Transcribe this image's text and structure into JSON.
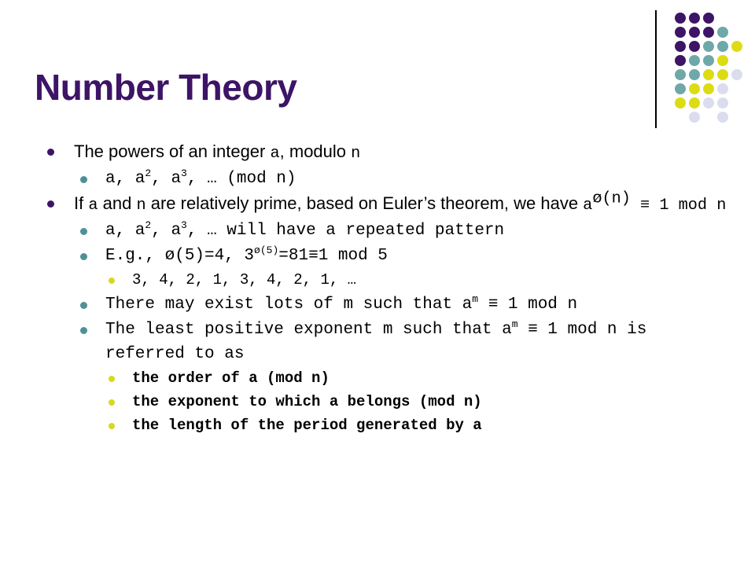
{
  "slide": {
    "title": "Number Theory",
    "title_color": "#3D1466",
    "background_color": "#FFFFFF"
  },
  "bullet_colors": {
    "level1": "#3D1466",
    "level2": "#4E9096",
    "level3": "#D9D91C"
  },
  "content": {
    "b1": {
      "pre": "The powers of an integer ",
      "mono1": "a",
      "mid": ", modulo ",
      "mono2": "n"
    },
    "b1_1": "a, a2, a3, … (mod n)",
    "b1_1_parts": {
      "p1": "a, a",
      "sup1": "2",
      "p2": ", a",
      "sup2": "3",
      "p3": ", … (mod n)"
    },
    "b2": {
      "pre": "If ",
      "mono1": "a",
      "mid1": " and ",
      "mono2": "n",
      "mid2": " are relatively prime, based on Euler’s theorem, we have ",
      "tail_base": "a",
      "tail_sup": "ø(n)",
      "tail_rest": " ≡ 1 mod n"
    },
    "b2_1": {
      "p1": "a, a",
      "sup1": "2",
      "p2": ", a",
      "sup2": "3",
      "p3": ", … will have a repeated pattern"
    },
    "b2_2": {
      "p1": "E.g., ø(5)=4, 3",
      "sup1": "ø(5)",
      "p2": "=81≡1 mod 5"
    },
    "b2_2_1": "3, 4, 2, 1, 3, 4, 2, 1, …",
    "b2_3": {
      "p1": "There may exist lots of m such that a",
      "sup1": "m",
      "p2": " ≡ 1 mod n"
    },
    "b2_4": {
      "p1": "The least positive exponent m such that a",
      "sup1": "m",
      "p2": " ≡ 1 mod n is referred to as"
    },
    "b2_4_1": "the order of a (mod n)",
    "b2_4_2": "the exponent to which a belongs (mod n)",
    "b2_4_3": "the length of the period generated by a"
  },
  "decoration": {
    "rule_color": "#000000",
    "palette": {
      "purple": "#3D1466",
      "teal": "#6FA8A8",
      "yellow": "#DCDC14",
      "lavender": "#DCDCEF"
    },
    "dots": [
      {
        "col": 0,
        "row": 0,
        "c": "purple"
      },
      {
        "col": 1,
        "row": 0,
        "c": "purple"
      },
      {
        "col": 2,
        "row": 0,
        "c": "purple"
      },
      {
        "col": 0,
        "row": 1,
        "c": "purple"
      },
      {
        "col": 1,
        "row": 1,
        "c": "purple"
      },
      {
        "col": 2,
        "row": 1,
        "c": "purple"
      },
      {
        "col": 3,
        "row": 1,
        "c": "teal"
      },
      {
        "col": 0,
        "row": 2,
        "c": "purple"
      },
      {
        "col": 1,
        "row": 2,
        "c": "purple"
      },
      {
        "col": 2,
        "row": 2,
        "c": "teal"
      },
      {
        "col": 3,
        "row": 2,
        "c": "teal"
      },
      {
        "col": 4,
        "row": 2,
        "c": "yellow"
      },
      {
        "col": 0,
        "row": 3,
        "c": "purple"
      },
      {
        "col": 1,
        "row": 3,
        "c": "teal"
      },
      {
        "col": 2,
        "row": 3,
        "c": "teal"
      },
      {
        "col": 3,
        "row": 3,
        "c": "yellow"
      },
      {
        "col": 0,
        "row": 4,
        "c": "teal"
      },
      {
        "col": 1,
        "row": 4,
        "c": "teal"
      },
      {
        "col": 2,
        "row": 4,
        "c": "yellow"
      },
      {
        "col": 3,
        "row": 4,
        "c": "yellow"
      },
      {
        "col": 4,
        "row": 4,
        "c": "lavender"
      },
      {
        "col": 0,
        "row": 5,
        "c": "teal"
      },
      {
        "col": 1,
        "row": 5,
        "c": "yellow"
      },
      {
        "col": 2,
        "row": 5,
        "c": "yellow"
      },
      {
        "col": 3,
        "row": 5,
        "c": "lavender"
      },
      {
        "col": 0,
        "row": 6,
        "c": "yellow"
      },
      {
        "col": 1,
        "row": 6,
        "c": "yellow"
      },
      {
        "col": 2,
        "row": 6,
        "c": "lavender"
      },
      {
        "col": 3,
        "row": 6,
        "c": "lavender"
      },
      {
        "col": 1,
        "row": 7,
        "c": "lavender"
      },
      {
        "col": 3,
        "row": 7,
        "c": "lavender"
      }
    ]
  }
}
